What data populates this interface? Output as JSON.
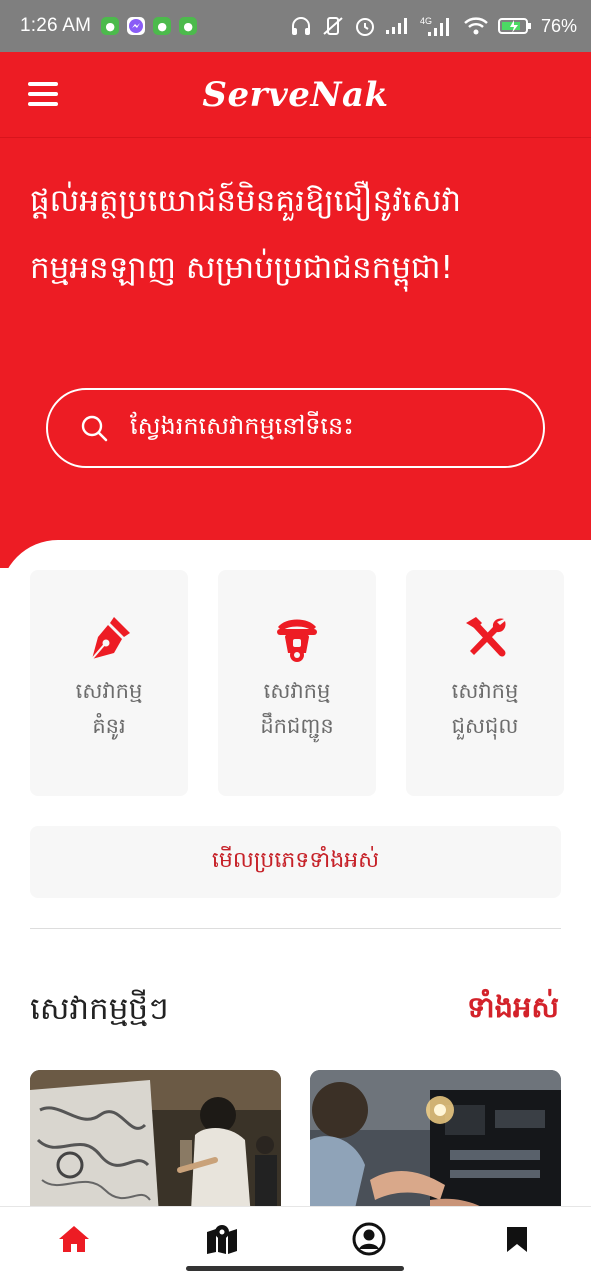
{
  "status_bar": {
    "time": "1:26 AM",
    "battery": "76%",
    "network": "4G"
  },
  "header": {
    "brand": "ServeNak",
    "menu_icon": "hamburger-menu-icon",
    "brand_color": "#ed1c24"
  },
  "hero": {
    "title": "ផ្តល់អត្ថប្រយោជន៍មិនគួរឱ្យជឿនូវសេវាកម្មអនឡាញ សម្រាប់ប្រជាជនកម្ពុជា!",
    "search_placeholder": "ស្វែងរកសេវាកម្មនៅទីនេះ",
    "search_icon": "search-icon"
  },
  "categories": [
    {
      "line1": "សេវាកម្ម",
      "line2": "គំនូរ",
      "icon": "pen-icon"
    },
    {
      "line1": "សេវាកម្ម",
      "line2": "ដឹកជញ្ជូន",
      "icon": "scooter-icon"
    },
    {
      "line1": "សេវាកម្ម",
      "line2": "ជួសជុល",
      "icon": "tools-icon"
    }
  ],
  "view_all_categories": "មើលប្រភេទទាំងអស់",
  "new_services": {
    "title": "សេវាកម្មថ្មីៗ",
    "link": "ទាំងអស់"
  },
  "bottom_nav": [
    {
      "icon": "home-icon",
      "active": true
    },
    {
      "icon": "map-icon",
      "active": false
    },
    {
      "icon": "profile-icon",
      "active": false
    },
    {
      "icon": "bookmark-icon",
      "active": false
    }
  ],
  "colors": {
    "accent": "#ed1c24",
    "accent_dark": "#c62128",
    "card_bg": "#f7f7f7",
    "muted_text": "#6b6b6b"
  }
}
